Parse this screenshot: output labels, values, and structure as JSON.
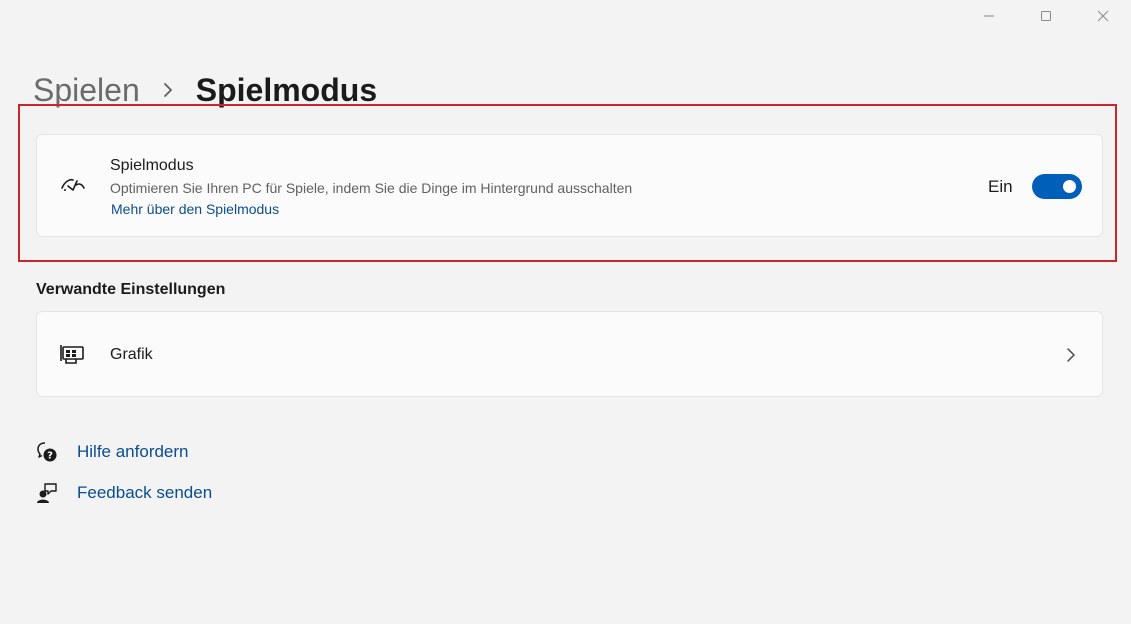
{
  "window_controls": {
    "minimize": "minimize-icon",
    "maximize": "maximize-icon",
    "close": "close-icon"
  },
  "breadcrumb": {
    "parent": "Spielen",
    "current": "Spielmodus"
  },
  "game_mode": {
    "icon": "game-mode-icon",
    "title": "Spielmodus",
    "description": "Optimieren Sie Ihren PC für Spiele, indem Sie die Dinge im Hintergrund ausschalten",
    "link": "Mehr über den Spielmodus",
    "toggle_state": "Ein",
    "toggle_on": true
  },
  "related": {
    "heading": "Verwandte Einstellungen",
    "items": [
      {
        "icon": "graphics-card-icon",
        "label": "Grafik"
      }
    ]
  },
  "help": {
    "items": [
      {
        "icon": "help-chat-icon",
        "label": "Hilfe anfordern"
      },
      {
        "icon": "feedback-icon",
        "label": "Feedback senden"
      }
    ]
  },
  "colors": {
    "accent": "#005fb8",
    "link": "#0a4d8f",
    "highlight_border": "#c8262b",
    "background": "#f3f3f3",
    "card": "#fbfbfb"
  }
}
